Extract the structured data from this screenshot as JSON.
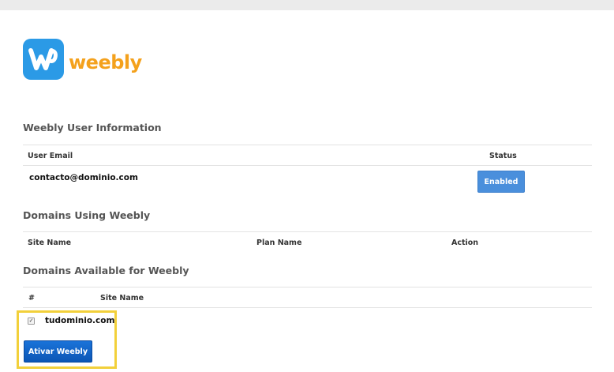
{
  "brand": {
    "name": "weebly",
    "logo_color": "#2b9ae6",
    "text_color": "#f4a11c"
  },
  "user_info": {
    "title": "Weebly User Information",
    "columns": {
      "email": "User Email",
      "status": "Status"
    },
    "email": "contacto@dominio.com",
    "status": "Enabled"
  },
  "domains_using": {
    "title": "Domains Using Weebly",
    "columns": {
      "site_name": "Site Name",
      "plan_name": "Plan Name",
      "action": "Action"
    }
  },
  "domains_available": {
    "title": "Domains Available for Weebly",
    "columns": {
      "index": "#",
      "site_name": "Site Name"
    },
    "rows": [
      {
        "checked": true,
        "site_name": "tudominio.com"
      }
    ],
    "activate_label": "Ativar Weebly"
  },
  "colors": {
    "button": "#0c56b5",
    "badge": "#4a8fdc",
    "highlight": "#f2d03b"
  }
}
